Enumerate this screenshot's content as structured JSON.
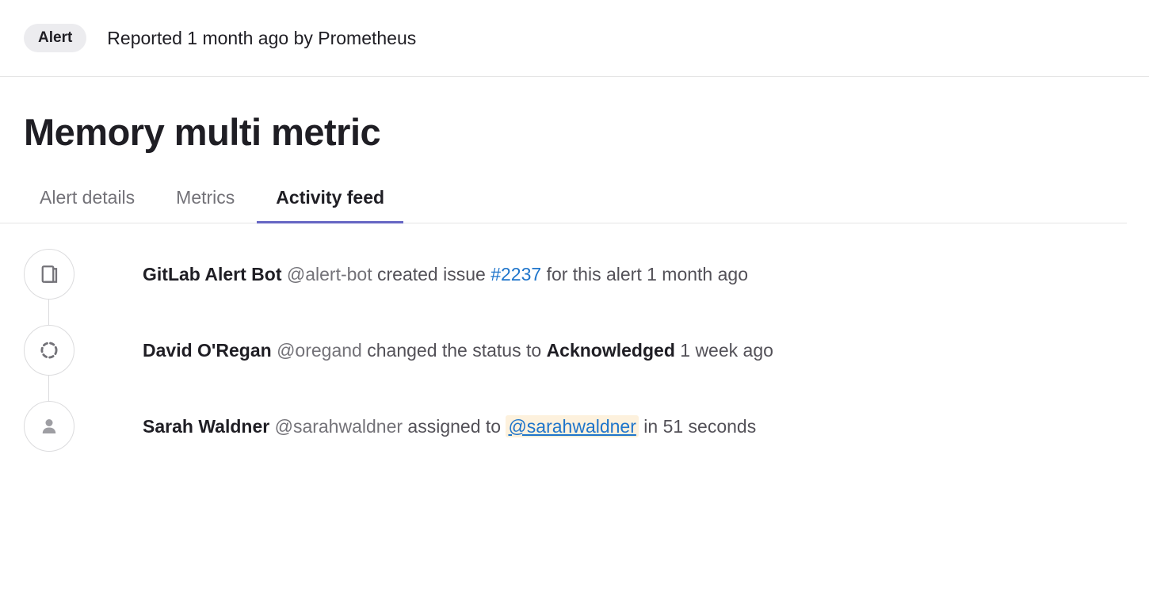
{
  "header": {
    "badge": "Alert",
    "reported": "Reported 1 month ago by Prometheus"
  },
  "title": "Memory multi metric",
  "tabs": {
    "details": "Alert details",
    "metrics": "Metrics",
    "activity": "Activity feed"
  },
  "feed": {
    "item1": {
      "author": "GitLab Alert Bot",
      "handle": "@alert-bot",
      "action1": "created issue",
      "issue": "#2237",
      "action2": "for this alert",
      "time": "1 month ago"
    },
    "item2": {
      "author": "David O'Regan",
      "handle": "@oregand",
      "action": "changed the status to",
      "status": "Acknowledged",
      "time": "1 week ago"
    },
    "item3": {
      "author": "Sarah Waldner",
      "handle": "@sarahwaldner",
      "action": "assigned to",
      "mention": "@sarahwaldner",
      "time": "in 51 seconds"
    }
  }
}
